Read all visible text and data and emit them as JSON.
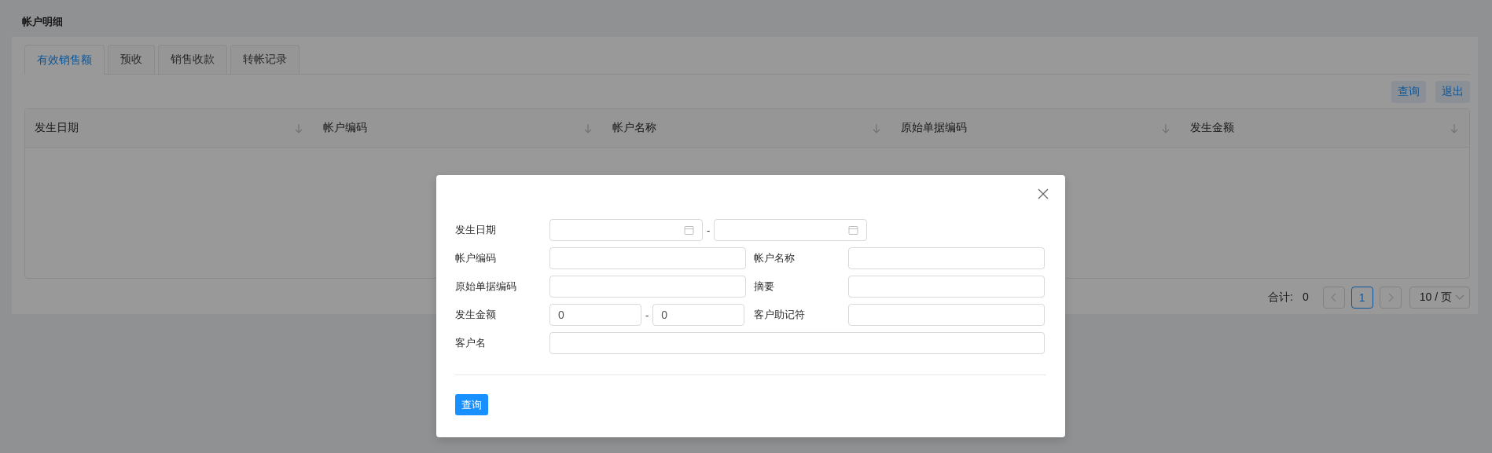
{
  "page": {
    "title": "帐户明细"
  },
  "tabs": [
    {
      "label": "有效销售额",
      "selected": true
    },
    {
      "label": "预收",
      "selected": false
    },
    {
      "label": "销售收款",
      "selected": false
    },
    {
      "label": "转帐记录",
      "selected": false
    }
  ],
  "toolbar": {
    "buttons": [
      "查询",
      "退出"
    ]
  },
  "table": {
    "columns": [
      "发生日期",
      "帐户编码",
      "帐户名称",
      "原始单据编码",
      "发生金额"
    ]
  },
  "pagination": {
    "total_label": "合计:",
    "total": "0",
    "pages": [
      {
        "label": "1",
        "selected": true
      }
    ],
    "page_size": "10 / 页"
  },
  "dialog": {
    "fields": [
      {
        "kind": "date_range",
        "label": "发生日期",
        "separator": "-"
      },
      {
        "kind": "text",
        "label": "帐户编码"
      },
      {
        "kind": "text",
        "label": "帐户名称"
      },
      {
        "kind": "text",
        "label": "原始单据编码"
      },
      {
        "kind": "text",
        "label": "摘要"
      },
      {
        "kind": "number_range",
        "label": "发生金额",
        "from": "0",
        "to": "0",
        "separator": "-"
      },
      {
        "kind": "text",
        "label": "客户助记符"
      },
      {
        "kind": "wide_text",
        "label": "客户名"
      }
    ],
    "submit": "查询"
  }
}
